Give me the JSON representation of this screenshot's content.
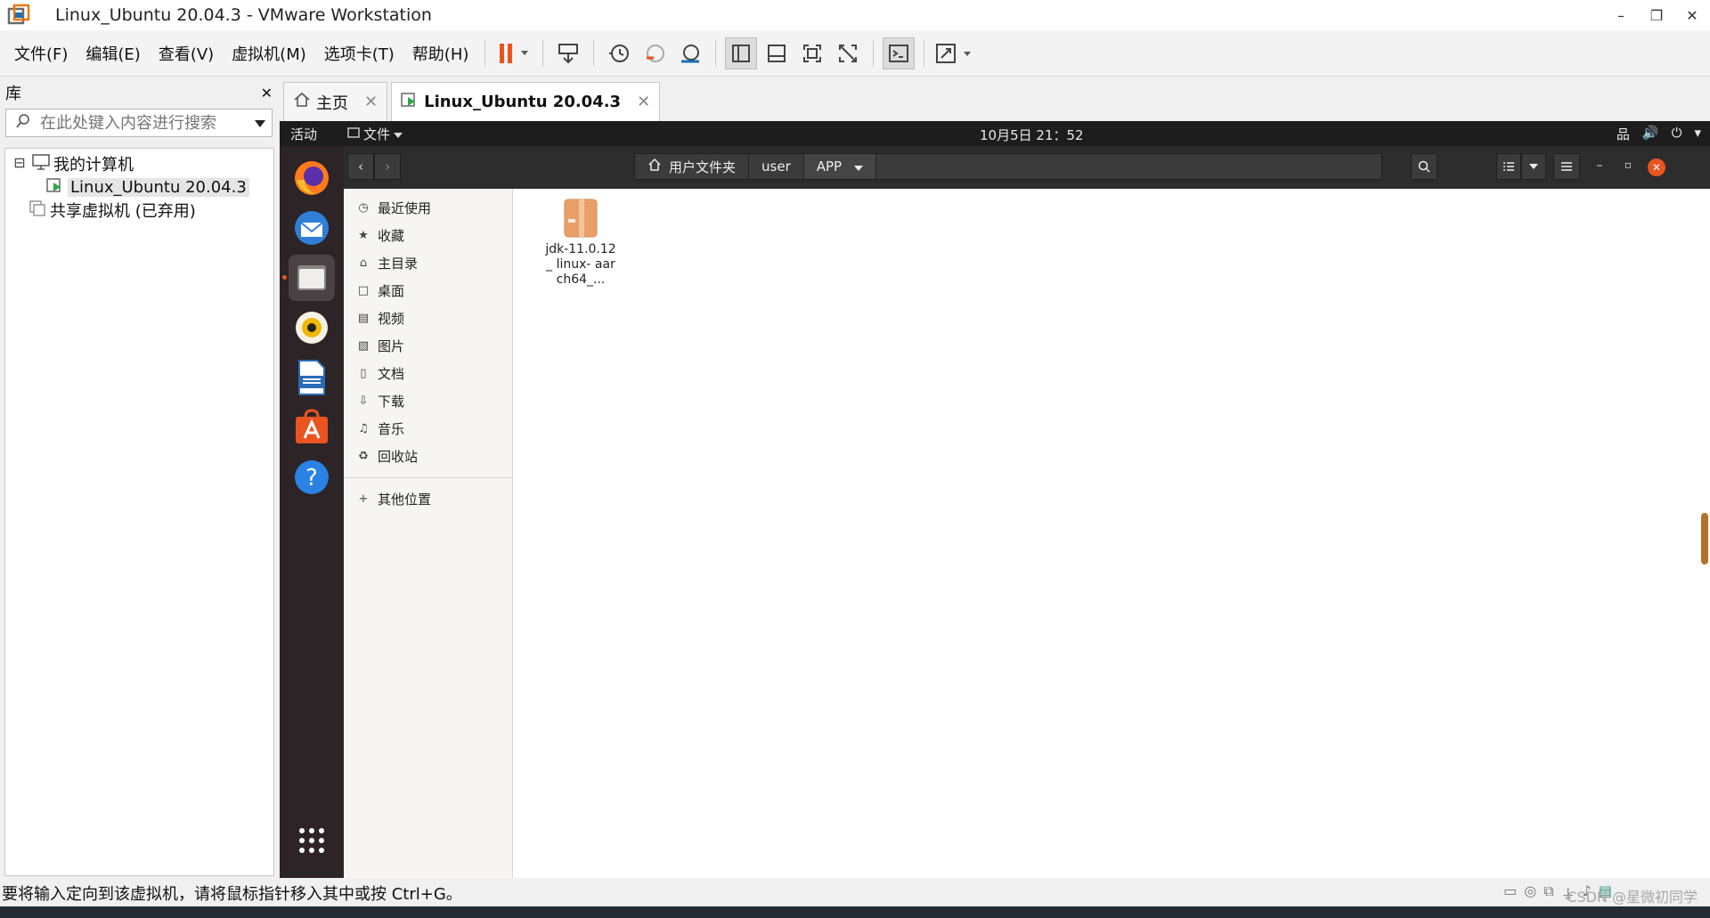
{
  "window": {
    "title": "Linux_Ubuntu 20.04.3 - VMware Workstation",
    "controls": [
      "–",
      "❐",
      "✕"
    ]
  },
  "menu": [
    "文件(F)",
    "编辑(E)",
    "查看(V)",
    "虚拟机(M)",
    "选项卡(T)",
    "帮助(H)"
  ],
  "library": {
    "title": "库",
    "close": "✕",
    "search_placeholder": "在此处键入内容进行搜索",
    "tree": {
      "root": "我的计算机",
      "root_expander": "⊟",
      "vm": "Linux_Ubuntu 20.04.3",
      "shared": "共享虚拟机 (已弃用)"
    }
  },
  "tabs": [
    {
      "label": "主页",
      "close": "✕"
    },
    {
      "label": "Linux_Ubuntu 20.04.3",
      "close": "✕"
    }
  ],
  "guest": {
    "activities": "活动",
    "app_menu": "文件",
    "clock": "10月5日  21：52",
    "tray": [
      "品",
      "🔊",
      "⏻",
      "▾"
    ],
    "nautilus": {
      "path": [
        "用户文件夹",
        "user",
        "APP"
      ],
      "places": [
        {
          "icon": "◷",
          "label": "最近使用"
        },
        {
          "icon": "★",
          "label": "收藏"
        },
        {
          "icon": "⌂",
          "label": "主目录"
        },
        {
          "icon": "□",
          "label": "桌面"
        },
        {
          "icon": "▤",
          "label": "视频"
        },
        {
          "icon": "▧",
          "label": "图片"
        },
        {
          "icon": "▯",
          "label": "文档"
        },
        {
          "icon": "⇩",
          "label": "下载"
        },
        {
          "icon": "♫",
          "label": "音乐"
        },
        {
          "icon": "♻",
          "label": "回收站"
        }
      ],
      "other_places": {
        "icon": "+",
        "label": "其他位置"
      },
      "files": [
        {
          "name": "jdk-11.0.12_ linux- aarch64_..."
        }
      ]
    }
  },
  "statusbar": {
    "text": "要将输入定向到该虚拟机，请将鼠标指针移入其中或按 Ctrl+G。",
    "watermark": "CSDN @星微初同学"
  },
  "colors": {
    "accent": "#e9541f",
    "dock_bg": "#2c2426",
    "guest_topbar": "#1d1d1d",
    "headerbar": "#2d2d2d"
  }
}
